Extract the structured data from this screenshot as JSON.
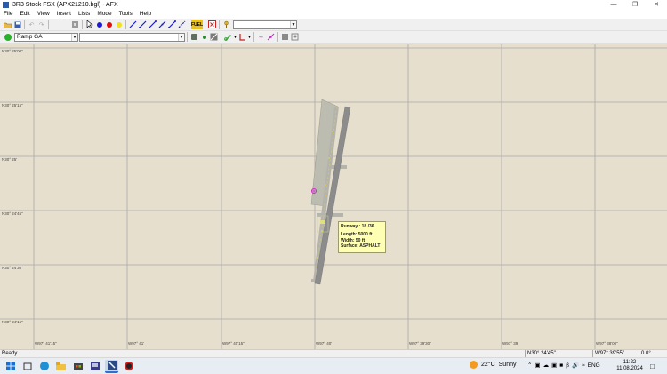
{
  "window": {
    "title": "3R3 Stock FSX (APX21210.bgl) - AFX",
    "controls": [
      "—",
      "❐",
      "✕"
    ]
  },
  "menu": [
    "File",
    "Edit",
    "View",
    "Insert",
    "Lists",
    "Mode",
    "Tools",
    "Help"
  ],
  "toolbar1": {
    "combo_value": "",
    "fuel_label": "FUEL"
  },
  "toolbar2": {
    "parking_combo": "Ramp GA",
    "second_combo": ""
  },
  "map": {
    "background": "#e6dfcd",
    "grid_color": "#a8a8a8",
    "lat_labels": [
      "N30° 25'00\"",
      "N30° 25'15\"",
      "N30° 25'",
      "N30° 24'45\"",
      "N30° 24'30\"",
      "N30° 24'15\""
    ],
    "lon_labels": [
      "W97° 41'15\"",
      "W97° 41'",
      "W97° 40'15\"",
      "W97° 40'",
      "W97° 39'30\"",
      "W97° 39'",
      "W97° 38'00\""
    ]
  },
  "tooltip": {
    "runway": "Runway : 18 /36",
    "length": "Length:   5000 ft",
    "width": "Width:    50 ft",
    "surface": "Surface: ASPHALT"
  },
  "status": {
    "text": "Ready",
    "lat": "N30° 24'45\"",
    "lon": "W97° 39'55\"",
    "heading": "0.0°"
  },
  "taskbar": {
    "weather_temp": "22°C",
    "weather_desc": "Sunny",
    "lang": "ENG",
    "time": "11:22",
    "date": "11.08.2024"
  }
}
